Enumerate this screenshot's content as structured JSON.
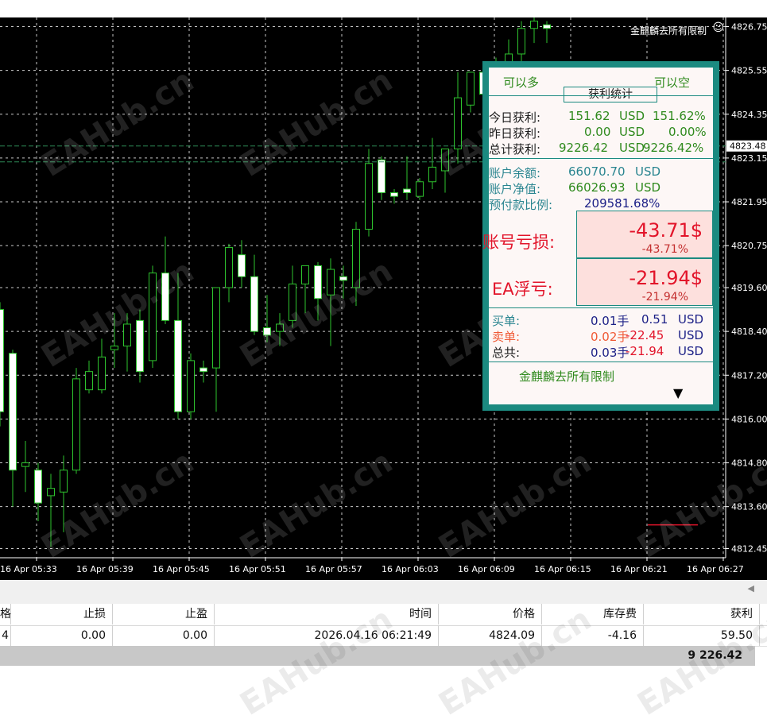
{
  "header": {
    "owner_label": "金麒麟去所有限制"
  },
  "watermark": "EAHub.cn",
  "price_axis": {
    "labels": [
      "4826.75",
      "4825.55",
      "4824.35",
      "4823.15",
      "4821.95",
      "4820.75",
      "4819.60",
      "4818.40",
      "4817.20",
      "4816.00",
      "4814.80",
      "4813.60",
      "4812.45"
    ],
    "current_price": "4823.48"
  },
  "time_axis": {
    "labels": [
      "16 Apr 05:33",
      "16 Apr 05:39",
      "16 Apr 05:45",
      "16 Apr 05:51",
      "16 Apr 05:57",
      "16 Apr 06:03",
      "16 Apr 06:09",
      "16 Apr 06:15",
      "16 Apr 06:21",
      "16 Apr 06:27"
    ]
  },
  "chart_data": {
    "type": "candlestick",
    "ylim": [
      4812.2,
      4827.0
    ],
    "candles": [
      {
        "o": 4819.0,
        "h": 4819.2,
        "l": 4815.8,
        "c": 4816.2
      },
      {
        "o": 4817.8,
        "h": 4817.9,
        "l": 4813.6,
        "c": 4814.6
      },
      {
        "o": 4814.7,
        "h": 4815.4,
        "l": 4814.0,
        "c": 4814.8
      },
      {
        "o": 4814.6,
        "h": 4814.8,
        "l": 4813.2,
        "c": 4813.7
      },
      {
        "o": 4813.9,
        "h": 4814.5,
        "l": 4812.5,
        "c": 4814.1
      },
      {
        "o": 4814.0,
        "h": 4815.0,
        "l": 4812.9,
        "c": 4814.6
      },
      {
        "o": 4814.6,
        "h": 4817.4,
        "l": 4814.5,
        "c": 4817.1
      },
      {
        "o": 4816.8,
        "h": 4817.6,
        "l": 4816.7,
        "c": 4817.3
      },
      {
        "o": 4816.8,
        "h": 4818.2,
        "l": 4816.7,
        "c": 4817.7
      },
      {
        "o": 4817.9,
        "h": 4818.9,
        "l": 4817.4,
        "c": 4818.0
      },
      {
        "o": 4818.0,
        "h": 4818.9,
        "l": 4817.3,
        "c": 4818.6
      },
      {
        "o": 4818.7,
        "h": 4819.0,
        "l": 4817.0,
        "c": 4817.3
      },
      {
        "o": 4817.6,
        "h": 4820.2,
        "l": 4817.4,
        "c": 4820.0
      },
      {
        "o": 4820.0,
        "h": 4821.0,
        "l": 4818.6,
        "c": 4818.7
      },
      {
        "o": 4818.7,
        "h": 4820.0,
        "l": 4816.0,
        "c": 4816.2
      },
      {
        "o": 4816.2,
        "h": 4817.8,
        "l": 4816.0,
        "c": 4817.6
      },
      {
        "o": 4817.4,
        "h": 4817.6,
        "l": 4817.0,
        "c": 4817.3
      },
      {
        "o": 4817.4,
        "h": 4819.5,
        "l": 4816.2,
        "c": 4819.6
      },
      {
        "o": 4819.6,
        "h": 4820.8,
        "l": 4819.2,
        "c": 4820.7
      },
      {
        "o": 4820.5,
        "h": 4820.9,
        "l": 4819.6,
        "c": 4819.9
      },
      {
        "o": 4819.9,
        "h": 4820.5,
        "l": 4818.3,
        "c": 4818.4
      },
      {
        "o": 4818.5,
        "h": 4819.4,
        "l": 4818.1,
        "c": 4818.3
      },
      {
        "o": 4818.4,
        "h": 4818.9,
        "l": 4818.0,
        "c": 4818.6
      },
      {
        "o": 4818.7,
        "h": 4820.2,
        "l": 4818.5,
        "c": 4819.7
      },
      {
        "o": 4819.7,
        "h": 4820.2,
        "l": 4818.9,
        "c": 4820.2
      },
      {
        "o": 4820.2,
        "h": 4820.3,
        "l": 4818.7,
        "c": 4819.3
      },
      {
        "o": 4819.4,
        "h": 4820.4,
        "l": 4818.0,
        "c": 4820.1
      },
      {
        "o": 4819.9,
        "h": 4820.2,
        "l": 4819.3,
        "c": 4819.8
      },
      {
        "o": 4819.6,
        "h": 4821.4,
        "l": 4819.1,
        "c": 4821.2
      },
      {
        "o": 4821.2,
        "h": 4823.4,
        "l": 4821.0,
        "c": 4823.0
      },
      {
        "o": 4823.1,
        "h": 4823.2,
        "l": 4822.0,
        "c": 4822.2
      },
      {
        "o": 4822.2,
        "h": 4822.3,
        "l": 4821.9,
        "c": 4822.1
      },
      {
        "o": 4822.3,
        "h": 4823.2,
        "l": 4822.0,
        "c": 4822.2
      },
      {
        "o": 4822.1,
        "h": 4822.6,
        "l": 4822.0,
        "c": 4822.5
      },
      {
        "o": 4822.5,
        "h": 4823.7,
        "l": 4822.3,
        "c": 4822.9
      },
      {
        "o": 4822.8,
        "h": 4823.1,
        "l": 4822.2,
        "c": 4823.4
      },
      {
        "o": 4823.4,
        "h": 4825.5,
        "l": 4823.0,
        "c": 4824.8
      },
      {
        "o": 4824.6,
        "h": 4825.2,
        "l": 4824.4,
        "c": 4825.5
      },
      {
        "o": 4825.5,
        "h": 4825.8,
        "l": 4824.8,
        "c": 4824.9
      },
      {
        "o": 4824.9,
        "h": 4825.9,
        "l": 4824.6,
        "c": 4825.5
      },
      {
        "o": 4825.5,
        "h": 4826.4,
        "l": 4825.2,
        "c": 4826.0
      },
      {
        "o": 4826.0,
        "h": 4826.9,
        "l": 4825.6,
        "c": 4826.7
      },
      {
        "o": 4826.7,
        "h": 4827.0,
        "l": 4826.3,
        "c": 4826.9
      },
      {
        "o": 4826.8,
        "h": 4826.9,
        "l": 4826.3,
        "c": 4826.7
      }
    ]
  },
  "panel": {
    "can_long": "可以多",
    "can_short": "可以空",
    "title": "获利统计",
    "rows": [
      {
        "label": "今日获利:",
        "amount": "151.62",
        "currency": "USD",
        "percent": "151.62%"
      },
      {
        "label": "昨日获利:",
        "amount": "0.00",
        "currency": "USD",
        "percent": "0.00%"
      },
      {
        "label": "总计获利:",
        "amount": "9226.42",
        "currency": "USD",
        "percent": "9226.42%"
      }
    ],
    "balance_label": "账户余额:",
    "balance_value": "66070.70",
    "balance_currency": "USD",
    "equity_label": "账户净值:",
    "equity_value": "66026.93",
    "equity_currency": "USD",
    "margin_label": "预付款比例:",
    "margin_value": "209581.68%",
    "account_loss_label": "账号亏损:",
    "account_loss_value": "-43.71$",
    "account_loss_pct": "-43.71%",
    "ea_float_label": "EA浮亏:",
    "ea_float_value": "-21.94$",
    "ea_float_pct": "-21.94%",
    "orders": [
      {
        "label": "买单:",
        "lots": "0.01手",
        "profit": "0.51",
        "currency": "USD"
      },
      {
        "label": "卖单:",
        "lots": "0.02手",
        "profit": "-22.45",
        "currency": "USD"
      },
      {
        "label": "总共:",
        "lots": "0.03手",
        "profit": "-21.94",
        "currency": "USD"
      }
    ],
    "footer": "金麒麟去所有限制",
    "dropdown_arrow": "▼"
  },
  "table": {
    "headers": [
      "格",
      "止损",
      "止盈",
      "时间",
      "价格",
      "库存费",
      "获利"
    ],
    "row": [
      "4",
      "0.00",
      "0.00",
      "2026.04.16 06:21:49",
      "4824.09",
      "-4.16",
      "59.50"
    ],
    "total": "9 226.42"
  }
}
